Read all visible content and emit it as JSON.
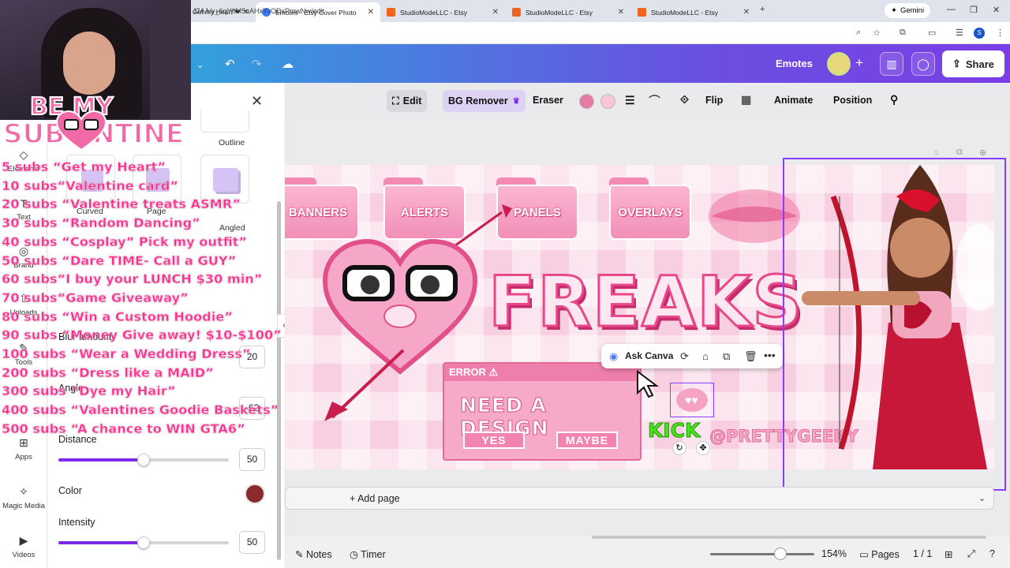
{
  "browser": {
    "tabs": [
      {
        "label": "Get my Heart\"❤",
        "icon": "heart-tab-icon"
      },
      {
        "label": "Emotes - Etsy Cover Photo",
        "icon": "canva-icon"
      },
      {
        "label": "StudioModeLLC - Etsy",
        "icon": "etsy-icon"
      },
      {
        "label": "StudioModeLLC - Etsy",
        "icon": "etsy-icon"
      },
      {
        "label": "StudioModeLLC - Etsy",
        "icon": "etsy-icon"
      }
    ],
    "gemini_label": "Gemini",
    "url": "J7AA/y_6qY0M5uAHxYvODxPmwNw/edit",
    "profile_initial": "S"
  },
  "canva_header": {
    "design_name": "Emotes",
    "share_label": "Share"
  },
  "toolbar": {
    "edit": "Edit",
    "bg_remover": "BG Remover",
    "eraser": "Eraser",
    "flip": "Flip",
    "animate": "Animate",
    "position": "Position",
    "colors": [
      "#e87aa6",
      "#f9c6d8"
    ]
  },
  "left_rail": {
    "items": [
      "Elements",
      "Text",
      "Brand",
      "Uploads",
      "Tools",
      "Apps",
      "Magic Media",
      "Videos"
    ]
  },
  "effects_panel": {
    "shapes": [
      "Outline",
      "Curved",
      "Page",
      "Angled"
    ],
    "blur_label": "Blur amount",
    "blur_value": "20",
    "angle_label": "Angle",
    "angle_value": "-62",
    "distance_label": "Distance",
    "distance_value": "50",
    "color_label": "Color",
    "color_value": "#8b2a2a",
    "intensity_label": "Intensity",
    "intensity_value": "50"
  },
  "canvas": {
    "folders": [
      "BANNERS",
      "ALERTS",
      "PANELS",
      "OVERLAYS"
    ],
    "title": "FREAKS",
    "error_label": "ERROR ⚠",
    "need_design": "NEED A DESIGN",
    "yes": "YES",
    "maybe": "MAYBE",
    "kick": "KICK",
    "handle": "@PRETTYGEEKY"
  },
  "ask_canva": {
    "label": "Ask Canva"
  },
  "footer": {
    "add_page": "+ Add page",
    "notes": "Notes",
    "timer": "Timer",
    "zoom": "154%",
    "pages": "Pages",
    "page_count": "1 / 1"
  },
  "stream_overlay": {
    "title_top": "BE   MY",
    "title_bottom": "SUB  ENTINE",
    "goals": [
      "5 subs “Get my Heart”",
      "10 subs“Valentine card”",
      "20 subs “Valentine treats ASMR”",
      "30 subs “Random Dancing”",
      "40 subs “Cosplay” Pick my outfit”",
      "50 subs “Dare TIME- Call a GUY”",
      "60 subs“I buy your LUNCH $30 min”",
      "70 subs“Game Giveaway”",
      "80 subs “Win a Custom Hoodie”",
      "90 subs “Money Give away! $10-$100”",
      "100 subs “Wear a Wedding Dress”",
      "200 subs “Dress like a MAID”",
      "300 subs “Dye my Hair”",
      "400 subs “Valentines Goodie Baskets”",
      "500 subs “A chance to WIN GTA6”"
    ]
  }
}
